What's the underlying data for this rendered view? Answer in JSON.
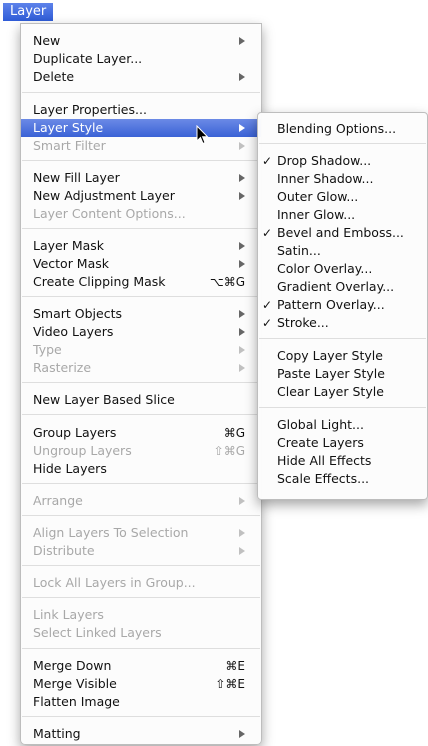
{
  "menubar": {
    "title": "Layer"
  },
  "main_menu": {
    "items": [
      {
        "label": "New",
        "submenu": true
      },
      {
        "label": "Duplicate Layer..."
      },
      {
        "label": "Delete",
        "submenu": true
      },
      {
        "label": "Layer Properties..."
      },
      {
        "label": "Layer Style",
        "submenu": true,
        "highlighted": true
      },
      {
        "label": "Smart Filter",
        "submenu": true,
        "disabled": true
      },
      {
        "label": "New Fill Layer",
        "submenu": true
      },
      {
        "label": "New Adjustment Layer",
        "submenu": true
      },
      {
        "label": "Layer Content Options...",
        "disabled": true
      },
      {
        "label": "Layer Mask",
        "submenu": true
      },
      {
        "label": "Vector Mask",
        "submenu": true
      },
      {
        "label": "Create Clipping Mask",
        "shortcut": "⌥⌘G"
      },
      {
        "label": "Smart Objects",
        "submenu": true
      },
      {
        "label": "Video Layers",
        "submenu": true
      },
      {
        "label": "Type",
        "submenu": true,
        "disabled": true
      },
      {
        "label": "Rasterize",
        "submenu": true,
        "disabled": true
      },
      {
        "label": "New Layer Based Slice"
      },
      {
        "label": "Group Layers",
        "shortcut": "⌘G"
      },
      {
        "label": "Ungroup Layers",
        "shortcut": "⇧⌘G",
        "disabled": true
      },
      {
        "label": "Hide Layers"
      },
      {
        "label": "Arrange",
        "submenu": true,
        "disabled": true
      },
      {
        "label": "Align Layers To Selection",
        "submenu": true,
        "disabled": true
      },
      {
        "label": "Distribute",
        "submenu": true,
        "disabled": true
      },
      {
        "label": "Lock All Layers in Group...",
        "disabled": true
      },
      {
        "label": "Link Layers",
        "disabled": true
      },
      {
        "label": "Select Linked Layers",
        "disabled": true
      },
      {
        "label": "Merge Down",
        "shortcut": "⌘E"
      },
      {
        "label": "Merge Visible",
        "shortcut": "⇧⌘E"
      },
      {
        "label": "Flatten Image"
      },
      {
        "label": "Matting",
        "submenu": true
      }
    ]
  },
  "layer_style_submenu": {
    "items": [
      {
        "label": "Blending Options..."
      },
      {
        "label": "Drop Shadow...",
        "checked": true
      },
      {
        "label": "Inner Shadow..."
      },
      {
        "label": "Outer Glow..."
      },
      {
        "label": "Inner Glow..."
      },
      {
        "label": "Bevel and Emboss...",
        "checked": true
      },
      {
        "label": "Satin..."
      },
      {
        "label": "Color Overlay..."
      },
      {
        "label": "Gradient Overlay..."
      },
      {
        "label": "Pattern Overlay...",
        "checked": true
      },
      {
        "label": "Stroke...",
        "checked": true
      },
      {
        "label": "Copy Layer Style"
      },
      {
        "label": "Paste Layer Style"
      },
      {
        "label": "Clear Layer Style"
      },
      {
        "label": "Global Light..."
      },
      {
        "label": "Create Layers"
      },
      {
        "label": "Hide All Effects"
      },
      {
        "label": "Scale Effects..."
      }
    ],
    "check_mark": "✓"
  },
  "colors": {
    "highlight": "#3a62d6",
    "disabled_text": "#a8a8a8"
  }
}
